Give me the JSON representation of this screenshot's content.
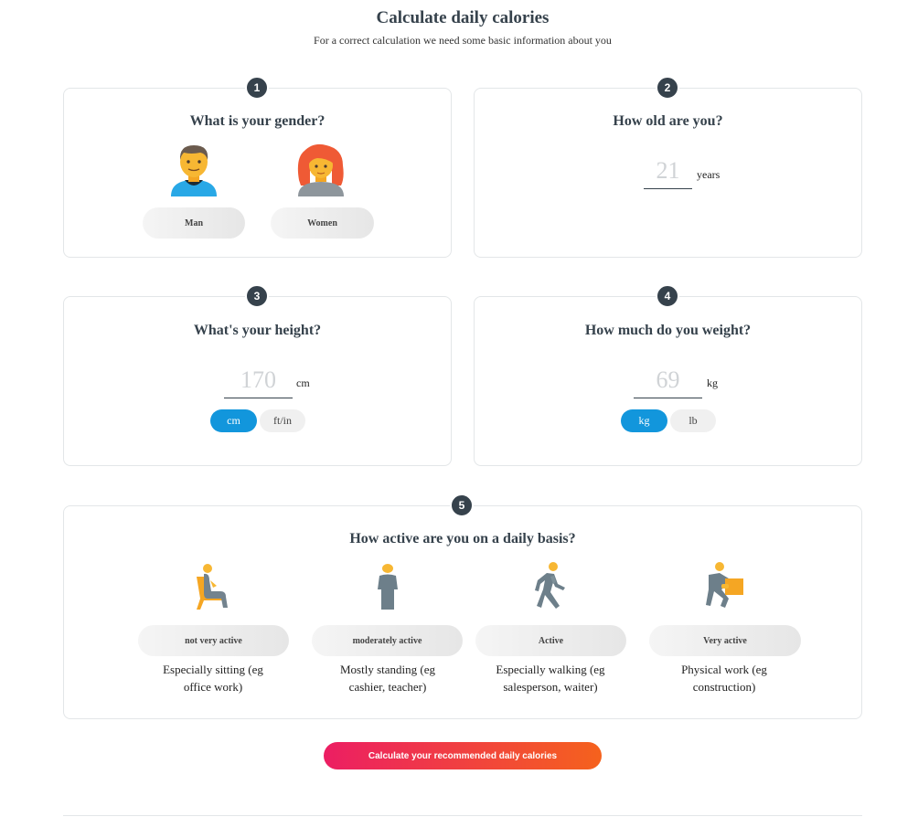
{
  "header": {
    "title": "Calculate daily calories",
    "subtitle": "For a correct calculation we need some basic information about you"
  },
  "gender": {
    "step": "1",
    "title": "What is your gender?",
    "options": [
      {
        "label": "Man",
        "icon": "man-icon"
      },
      {
        "label": "Women",
        "icon": "woman-icon"
      }
    ]
  },
  "age": {
    "step": "2",
    "title": "How old are you?",
    "placeholder": "21",
    "unit": "years"
  },
  "height": {
    "step": "3",
    "title": "What's your height?",
    "placeholder": "170",
    "unit": "cm",
    "units": [
      {
        "label": "cm",
        "active": true
      },
      {
        "label": "ft/in",
        "active": false
      }
    ]
  },
  "weight": {
    "step": "4",
    "title": "How much do you weight?",
    "placeholder": "69",
    "unit": "kg",
    "units": [
      {
        "label": "kg",
        "active": true
      },
      {
        "label": "lb",
        "active": false
      }
    ]
  },
  "activity": {
    "step": "5",
    "title": "How active are you on a daily basis?",
    "options": [
      {
        "label": "not very active",
        "description": "Especially sitting (eg office work)",
        "icon": "sitting-person-icon"
      },
      {
        "label": "moderately active",
        "description": "Mostly standing (eg cashier, teacher)",
        "icon": "standing-person-icon"
      },
      {
        "label": "Active",
        "description": "Especially walking (eg salesperson, waiter)",
        "icon": "walking-person-icon"
      },
      {
        "label": "Very active",
        "description": "Physical work (eg construction)",
        "icon": "carrying-box-person-icon"
      }
    ]
  },
  "cta": {
    "label": "Calculate your recommended daily calories"
  },
  "colors": {
    "accent_blue": "#1296dc",
    "badge": "#36424c",
    "cta_start": "#ec1e63",
    "cta_end": "#f5621d"
  }
}
